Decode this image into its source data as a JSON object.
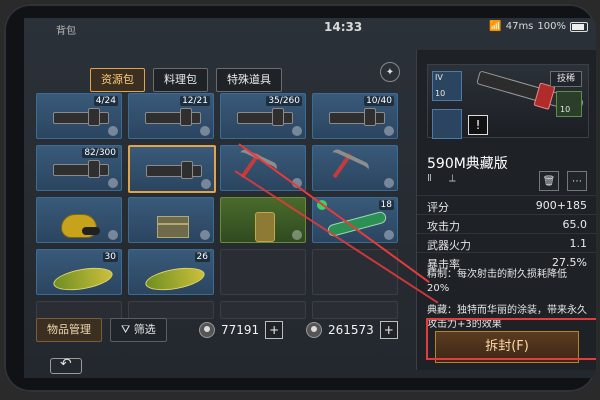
{
  "statusbar": {
    "left_label": "背包",
    "time": "14:33",
    "network": "47ms",
    "battery": "100%"
  },
  "tabs": [
    {
      "label": "资源包"
    },
    {
      "label": "料理包"
    },
    {
      "label": "特殊道具"
    }
  ],
  "grid": {
    "counts": [
      "4/24",
      "12/21",
      "35/260",
      "10/40",
      "82/300",
      "18",
      "30",
      "26"
    ]
  },
  "bottom": {
    "manage_label": "物品管理",
    "filter_label": "筛选",
    "currency1": "77191",
    "currency2": "261573"
  },
  "panel": {
    "roman": "IV",
    "level_left": "10",
    "badge_label": "技稀",
    "badge_level": "10",
    "item_name": "590M典藏版",
    "stats": [
      {
        "k": "评分",
        "v": "900+185"
      },
      {
        "k": "攻击力",
        "v": "65.0"
      },
      {
        "k": "武器火力",
        "v": "1.1"
      },
      {
        "k": "暴击率",
        "v": "27.5%"
      }
    ],
    "desc1_label": "精制：",
    "desc1_text": "每次射击的耐久损耗降低20%",
    "desc2_label": "典藏：",
    "desc2_text": "独特而华丽的涂装，带来永久攻击力+3的效果",
    "unseal_label": "拆封(F)"
  }
}
